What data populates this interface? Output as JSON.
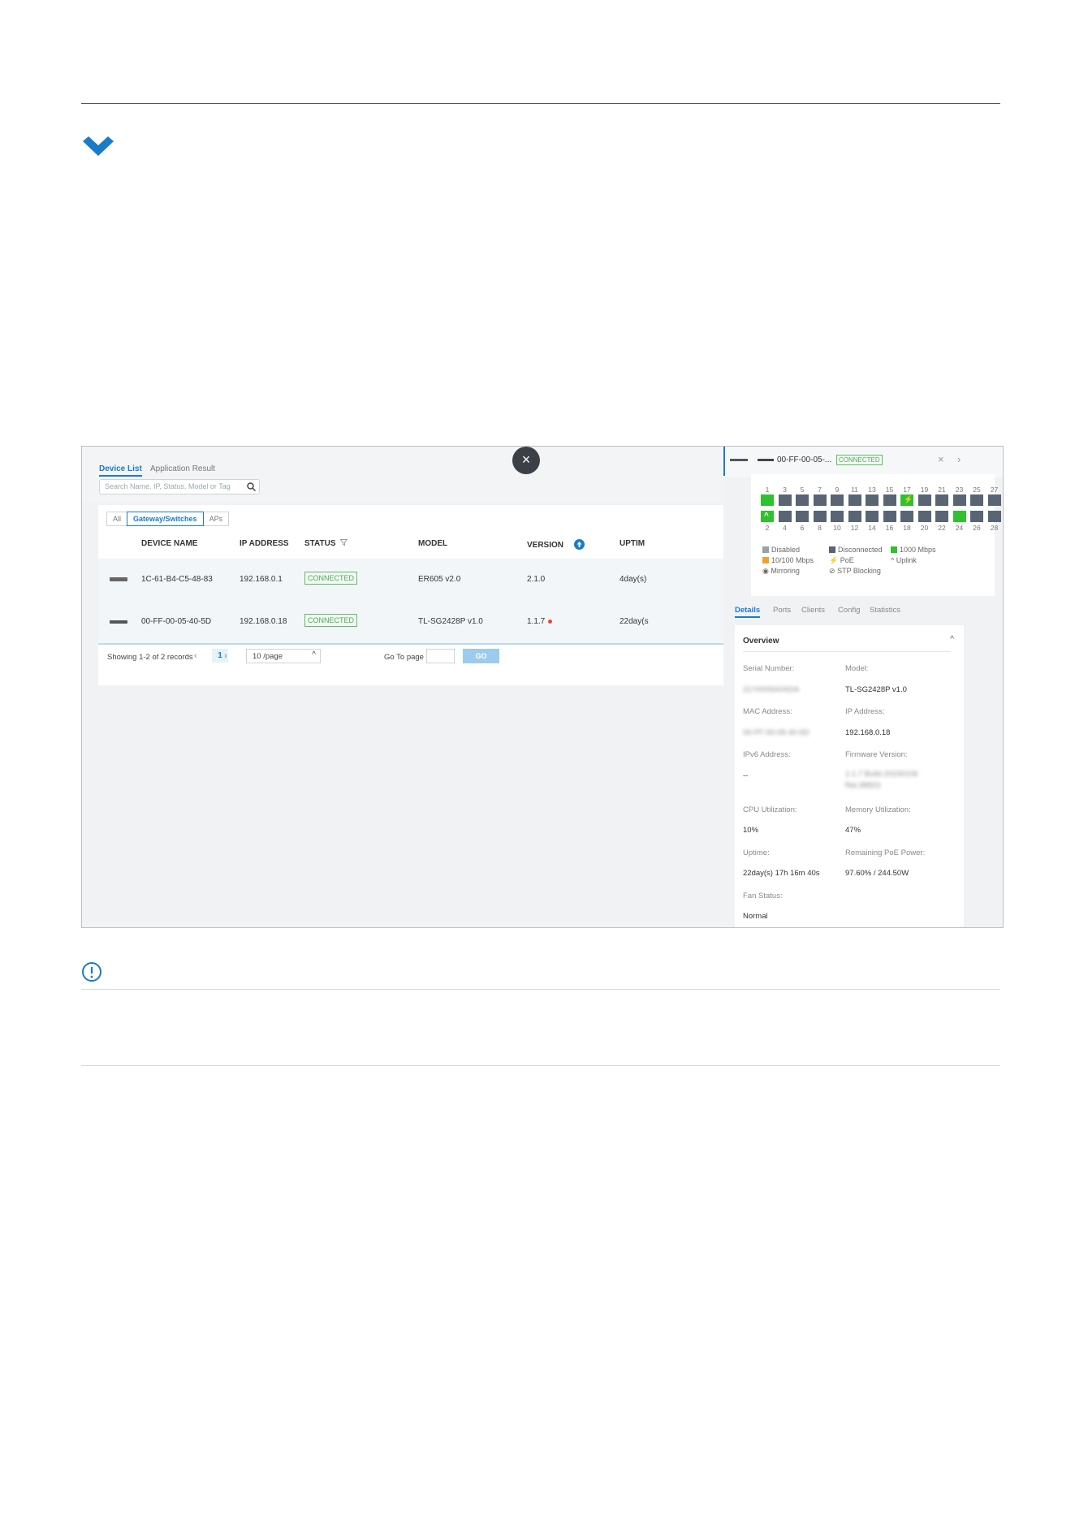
{
  "screenshot": {
    "tabs": [
      {
        "label": "Device List",
        "active": true
      },
      {
        "label": "Application Result",
        "active": false
      }
    ],
    "search": {
      "placeholder": "Search Name, IP, Status, Model or Tag"
    },
    "close_symbol": "×",
    "filters": [
      {
        "label": "All",
        "active": false
      },
      {
        "label": "Gateway/Switches",
        "active": true
      },
      {
        "label": "APs",
        "active": false
      }
    ],
    "columns": [
      "DEVICE NAME",
      "IP ADDRESS",
      "STATUS",
      "MODEL",
      "VERSION",
      "UPTIM"
    ],
    "rows": [
      {
        "name": "1C-61-B4-C5-48-83",
        "ip": "192.168.0.1",
        "status": "CONNECTED",
        "model": "ER605 v2.0",
        "version": "2.1.0",
        "uptime": "4day(s)"
      },
      {
        "name": "00-FF-00-05-40-5D",
        "ip": "192.168.0.18",
        "status": "CONNECTED",
        "model": "TL-SG2428P v1.0",
        "version": "1.1.7",
        "uptime": "22day(s"
      }
    ],
    "footer": {
      "showing": "Showing 1-2 of 2 records",
      "prev": "‹",
      "page": "1",
      "next": "›",
      "per_page": "10 /page",
      "per_page_caret": "^",
      "goto_label": "Go To page",
      "go_button": "GO"
    }
  },
  "drawer": {
    "title": "00-FF-00-05-...",
    "status": "CONNECTED",
    "close_symbol": "×",
    "next_symbol": "›",
    "ports_top": [
      "1",
      "3",
      "5",
      "7",
      "9",
      "11",
      "13",
      "15",
      "17",
      "19",
      "21",
      "23",
      "25",
      "27"
    ],
    "ports_bottom": [
      "2",
      "4",
      "6",
      "8",
      "10",
      "12",
      "14",
      "16",
      "18",
      "20",
      "22",
      "24",
      "26",
      "28"
    ],
    "poe_symbol": "⚡",
    "uplink_symbol": "^",
    "legend": {
      "disabled": "Disabled",
      "disconnected": "Disconnected",
      "gig": "1000 Mbps",
      "fast": "10/100 Mbps",
      "poe": "PoE",
      "uplink": "Uplink",
      "mirroring": "Mirroring",
      "stp": "STP Blocking"
    },
    "legend_icons": {
      "poe": "⚡",
      "uplink": "^",
      "mirroring": "◉",
      "stp": "⊘"
    },
    "colors": {
      "disabled": "#9aa0a8",
      "disconnected": "#596474",
      "gig": "#2fc12f",
      "fast": "#f0a030",
      "accent": "#1a7bc9"
    },
    "tabs": [
      "Details",
      "Ports",
      "Clients",
      "Config",
      "Statistics"
    ],
    "overview": {
      "title": "Overview",
      "collapse_symbol": "^",
      "fields": {
        "serial_label": "Serial Number:",
        "serial_value": "21Y0005A0SDA",
        "model_label": "Model:",
        "model_value": "TL-SG2428P v1.0",
        "mac_label": "MAC Address:",
        "mac_value": "00-FF-00-05-40-5D",
        "ip_label": "IP Address:",
        "ip_value": "192.168.0.18",
        "ipv6_label": "IPv6 Address:",
        "ipv6_value": "--",
        "fw_label": "Firmware Version:",
        "fw_value_1": "1.1.7 Build 20230106",
        "fw_value_2": "Rel.38823",
        "cpu_label": "CPU Utilization:",
        "cpu_value": "10%",
        "mem_label": "Memory Utilization:",
        "mem_value": "47%",
        "uptime_label": "Uptime:",
        "uptime_value": "22day(s) 17h 16m 40s",
        "poe_label": "Remaining PoE Power:",
        "poe_value": "97.60% / 244.50W",
        "fan_label": "Fan Status:",
        "fan_value": "Normal"
      }
    }
  }
}
